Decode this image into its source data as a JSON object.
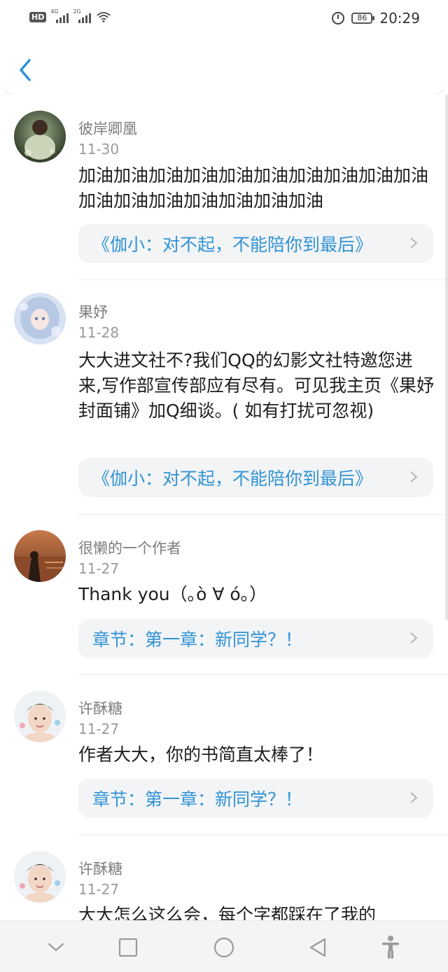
{
  "status_bar": {
    "hd": "HD",
    "sig1_label": "4G",
    "sig2_label": "2G",
    "battery": "86",
    "time": "20:29"
  },
  "comments": [
    {
      "name": "彼岸卿凰",
      "date": "11-30",
      "body": "加油加油加油加油加油加油加油加油加油加油加油加油加油加油加油加油加油",
      "ref": "《伽小：对不起，不能陪你到最后》"
    },
    {
      "name": "果妤",
      "date": "11-28",
      "body": "大大进文社不?我们QQ的幻影文社特邀您进来,写作部宣传部应有尽有。可见我主页《果妤封面铺》加Q细谈。( 如有打扰可忽视)",
      "ref": "《伽小：对不起，不能陪你到最后》"
    },
    {
      "name": "很懒的一个作者",
      "date": "11-27",
      "body": "Thank you（｡ò ∀ ó｡）",
      "ref": "章节：第一章：新同学？！"
    },
    {
      "name": "许酥糖",
      "date": "11-27",
      "body": "作者大大，你的书简直太棒了！",
      "ref": "章节：第一章：新同学？！"
    },
    {
      "name": "许酥糖",
      "date": "11-27",
      "body": "大大怎么这么会，每个字都踩在了我的"
    }
  ]
}
